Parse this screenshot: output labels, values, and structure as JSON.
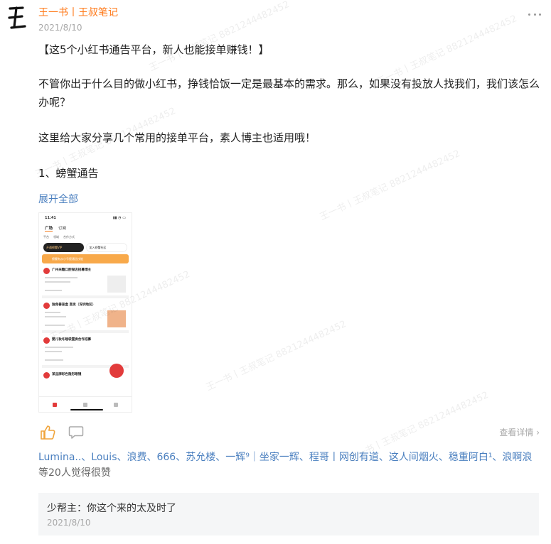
{
  "post": {
    "author": "王一书丨王叔笔记",
    "date": "2021/8/10",
    "title": "【这5个小红书通告平台，新人也能接单赚钱！】",
    "para1": "不管你出于什么目的做小红书，挣钱恰饭一定是最基本的需求。那么，如果没有投放人找我们，我们该怎么办呢？",
    "para2": "这里给大家分享几个常用的接单平台，素人博主也适用哦！",
    "para3": "1、螃蟹通告",
    "expand_label": "展开全部"
  },
  "screenshot": {
    "time": "11:41",
    "tab_active": "广场",
    "tab_other": "订阅",
    "filters": [
      "平台",
      "领域",
      "合作方式"
    ],
    "vip_label": "开通螃蟹VIP",
    "join_label": "加入螃蟹社区",
    "banner": "螃蟹有从小号接通告技能",
    "cards": [
      "广州米糖口腔探店招募博主",
      "独角兽盲盒 直发（深圳地区）",
      "婴儿秋冬睡袋置换合作招募",
      "某品牌彩色隐形眼镜"
    ],
    "fab_label": "发通告"
  },
  "actions": {
    "view_detail": "查看详情"
  },
  "likers": {
    "names": "Lumina..、Louis、浪费、666、苏允楼、一辉⁹｜坐家一辉、程哥丨网创有道、这人间烟火、稳重阿白¹、浪啊浪",
    "suffix": " 等20人觉得很赞"
  },
  "comment": {
    "text": "少帮主：你这个来的太及时了",
    "date": "2021/8/10"
  },
  "watermark": "王一书丨王叔笔记 8821244482452",
  "colors": {
    "accent_orange": "#ff7a1a",
    "link_blue": "#4a7fbf"
  }
}
